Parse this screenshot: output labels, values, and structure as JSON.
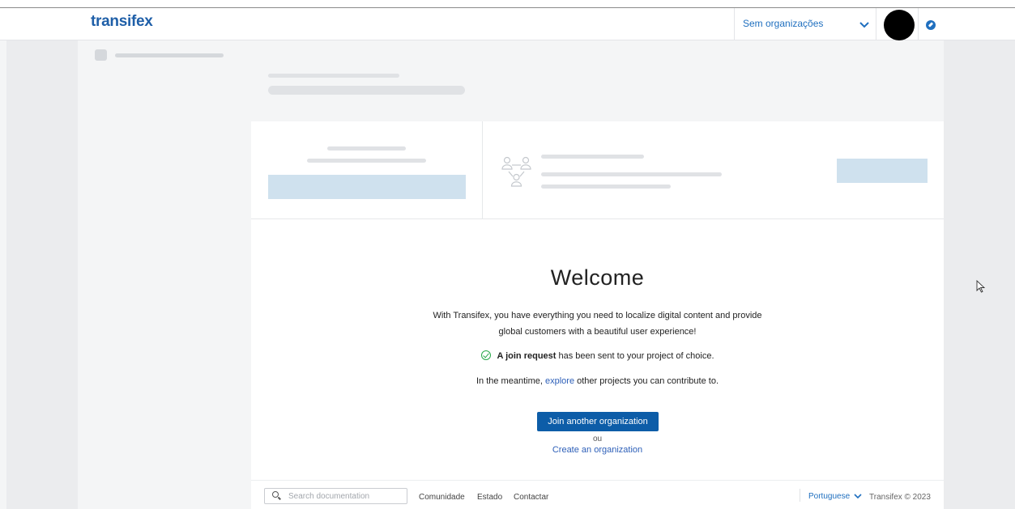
{
  "header": {
    "logo": "transifex",
    "org_selector_label": "Sem organizações",
    "org_chevron_icon": "chevron-down-icon",
    "compass_icon": "compass-icon",
    "accent_color": "#1f6fbf"
  },
  "main": {
    "welcome_title": "Welcome",
    "description_line1": "With Transifex, you have everything you need to localize digital content and provide",
    "description_line2": "global customers with a beautiful user experience!",
    "join_request_bold": "A join request",
    "join_request_rest": " has been sent to your project of choice.",
    "meantime_prefix": "In the meantime, ",
    "meantime_link": "explore",
    "meantime_suffix": " other projects you can contribute to.",
    "join_button": "Join another organization",
    "or_text": "ou",
    "create_link": "Create an organization",
    "primary_color": "#0d5da8",
    "success_color": "#2aa84a"
  },
  "footer": {
    "search_placeholder": "Search documentation",
    "links": [
      "Comunidade",
      "Estado",
      "Contactar"
    ],
    "language": "Portuguese",
    "copyright": "Transifex © 2023"
  }
}
